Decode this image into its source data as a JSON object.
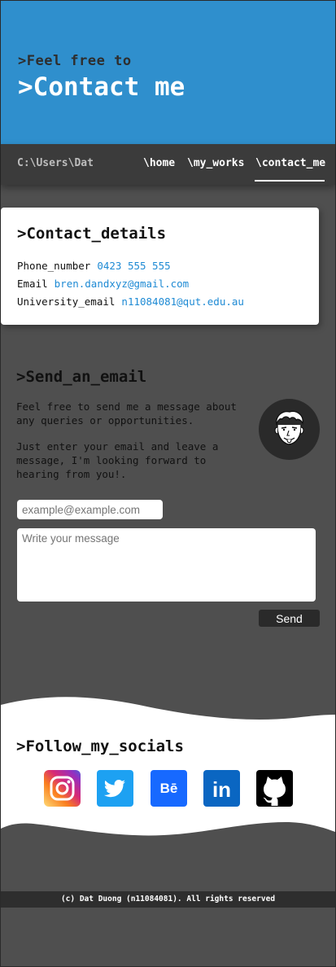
{
  "hero": {
    "subtitle": ">Feel free to",
    "title": ">Contact me"
  },
  "nav": {
    "path": "C:\\Users\\Dat",
    "links": [
      {
        "label": "\\home"
      },
      {
        "label": "\\my_works"
      },
      {
        "label": "\\contact_me",
        "active": true
      }
    ]
  },
  "contact_details": {
    "title": ">Contact_details",
    "rows": [
      {
        "label": "Phone_number",
        "value": "0423 555 555"
      },
      {
        "label": "Email",
        "value": "bren.dandxyz@gmail.com"
      },
      {
        "label": "University_email",
        "value": "n11084081@qut.edu.au"
      }
    ]
  },
  "send_email": {
    "title": ">Send_an_email",
    "paragraph1": "Feel free to send me a message about any queries or opportunities.",
    "paragraph2": "Just enter your email and leave a message, I'm looking forward to hearing from you!.",
    "email_placeholder": "example@example.com",
    "email_value": "",
    "message_placeholder": "Write your message",
    "message_value": "",
    "send_label": "Send"
  },
  "socials": {
    "title": ">Follow_my_socials",
    "items": [
      {
        "icon": "instagram-icon",
        "color": "#e1306c"
      },
      {
        "icon": "twitter-icon",
        "color": "#1da1f2"
      },
      {
        "icon": "behance-icon",
        "color": "#1769ff",
        "glyph": "Bē"
      },
      {
        "icon": "linkedin-icon",
        "color": "#0a66c2",
        "glyph": "in"
      },
      {
        "icon": "github-icon",
        "color": "#000000"
      }
    ]
  },
  "footer": {
    "text": "(c) Dat Duong (n11084081). All rights reserved"
  },
  "colors": {
    "accent": "#2f8fcd",
    "link": "#1e8ad4",
    "background": "#4f4f4f",
    "nav": "#3b3b3b"
  }
}
